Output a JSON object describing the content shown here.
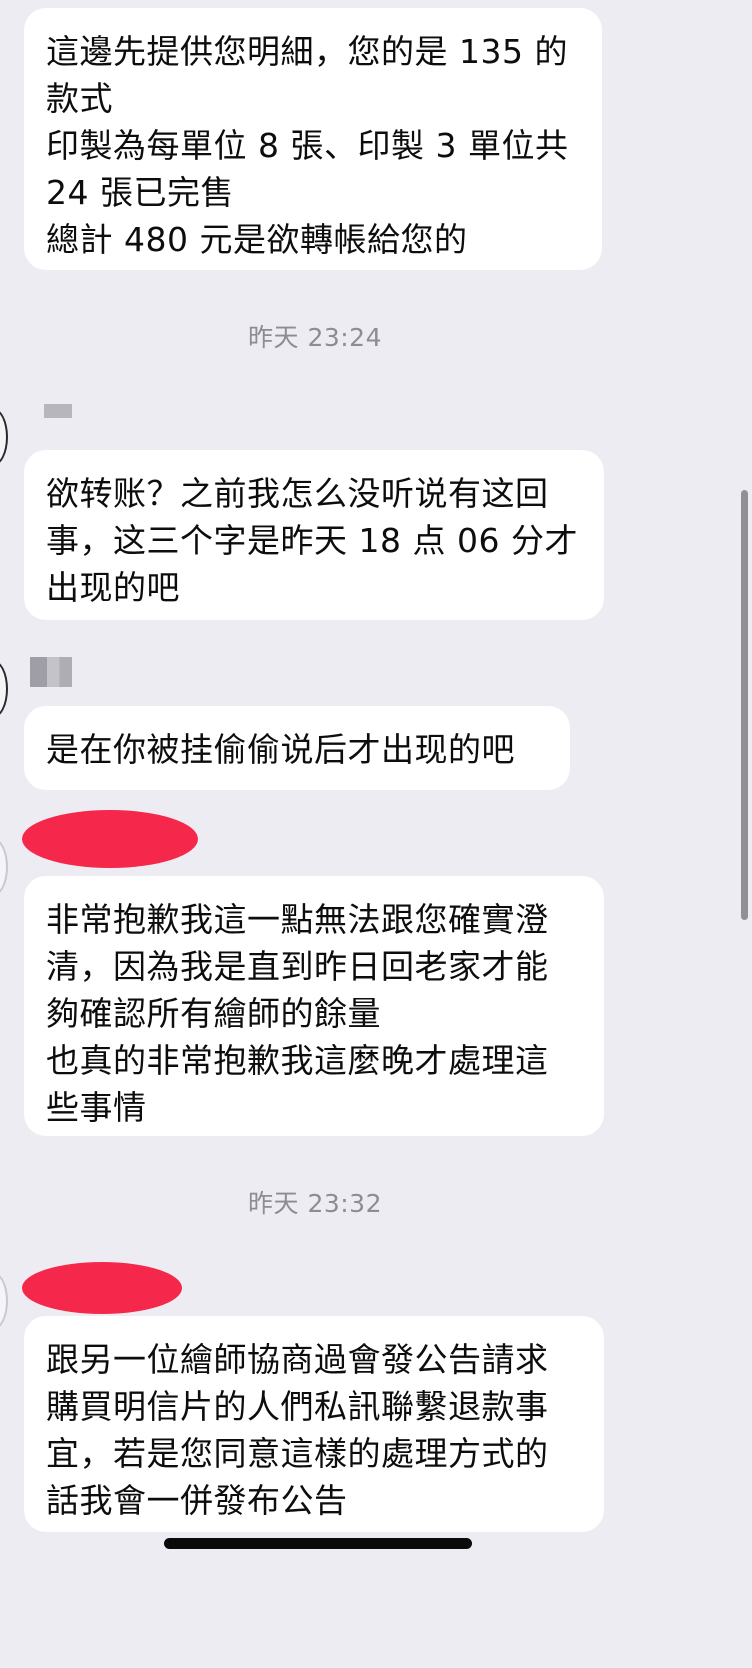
{
  "messages": [
    {
      "lines": [
        "這邊先提供您明細，您的是 135 的",
        "款式",
        "印製為每單位 8 張、印製 3 單位共",
        "24 張已完售",
        "總計 480 元是欲轉帳給您的"
      ]
    },
    {
      "lines": [
        "欲转账？之前我怎么没听说有这回",
        "事，这三个字是昨天 18 点 06 分才",
        "出现的吧"
      ]
    },
    {
      "lines": [
        "是在你被挂偷偷说后才出现的吧"
      ]
    },
    {
      "lines": [
        "非常抱歉我這一點無法跟您確實澄",
        "清，因為我是直到昨日回老家才能",
        "夠確認所有繪師的餘量",
        "也真的非常抱歉我這麼晚才處理這",
        "些事情"
      ]
    },
    {
      "lines": [
        "跟另一位繪師協商過會發公告請求",
        "購買明信片的人們私訊聯繫退款事",
        "宜，若是您同意這樣的處理方式的",
        "話我會一併發布公告"
      ]
    }
  ],
  "timestamps": [
    "昨天 23:24",
    "昨天 23:32"
  ],
  "colors": {
    "background": "#edecf2",
    "bubble": "#ffffff",
    "text": "#0d0d0d",
    "timestamp": "#8d8c93",
    "redaction": "#f5274a"
  }
}
